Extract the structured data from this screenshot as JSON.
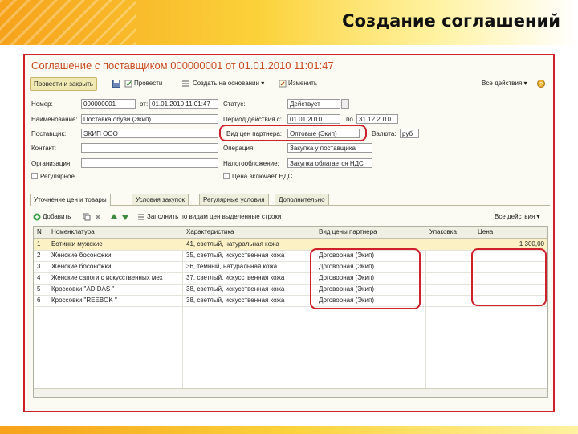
{
  "slide": {
    "title": "Создание соглашений"
  },
  "window": {
    "title": "Соглашение с поставщиком 000000001 от 01.01.2010 11:01:47"
  },
  "toolbar": {
    "post_close": "Провести и закрыть",
    "post": "Провести",
    "create_based": "Создать на основании",
    "edit": "Изменить",
    "all_actions": "Все действия"
  },
  "form": {
    "number_label": "Номер:",
    "number": "000000001",
    "from_label": "от:",
    "date": "01.01.2010 11:01:47",
    "status_label": "Статус:",
    "status": "Действует",
    "name_label": "Наименование:",
    "name": "Поставка обуви (Экип)",
    "period_label": "Период действия с:",
    "period_from": "01.01.2010",
    "to_label": "по",
    "period_to": "31.12.2010",
    "supplier_label": "Поставщик:",
    "supplier": "ЭКИП ООО",
    "price_type_label": "Вид цен партнера:",
    "price_type": "Оптовые (Экип)",
    "currency_label": "Валюта:",
    "currency": "руб",
    "contact_label": "Контакт:",
    "contact": "",
    "operation_label": "Операция:",
    "operation": "Закупка у поставщика",
    "org_label": "Организация:",
    "org": "",
    "tax_label": "Налогообложение:",
    "tax": "Закупка облагается НДС",
    "regular_label": "Регулярное",
    "vat_label": "Цена включает НДС"
  },
  "tabs": [
    "Уточнение цен и товары",
    "Условия закупок",
    "Регулярные условия",
    "Дополнительно"
  ],
  "subtoolbar": {
    "add": "Добавить",
    "fill": "Заполнить по видам цен выделенные строки",
    "all_actions": "Все действия"
  },
  "grid": {
    "headers": [
      "N",
      "Номенклатура",
      "Характеристика",
      "Вид цены партнера",
      "Упаковка",
      "Цена"
    ],
    "rows": [
      {
        "n": "1",
        "item": "Ботинки мужские",
        "char": "41, светлый, натуральная кожа",
        "price_type": "",
        "pack": "",
        "price": "1 300,00"
      },
      {
        "n": "2",
        "item": "Женские босоножки",
        "char": "35, светлый, искусственная кожа",
        "price_type": "Договорная (Экип)",
        "pack": "",
        "price": ""
      },
      {
        "n": "3",
        "item": "Женские босоножки",
        "char": "36, темный, натуральная кожа",
        "price_type": "Договорная (Экип)",
        "pack": "",
        "price": ""
      },
      {
        "n": "4",
        "item": "Женские сапоги с искусственных мех",
        "char": "37, светлый, искусственная кожа",
        "price_type": "Договорная (Экип)",
        "pack": "",
        "price": ""
      },
      {
        "n": "5",
        "item": "Кроссовки \"ADIDAS \"",
        "char": "38, светлый, искусственная кожа",
        "price_type": "Договорная (Экип)",
        "pack": "",
        "price": ""
      },
      {
        "n": "6",
        "item": "Кроссовки \"REEBOK \"",
        "char": "38, светлый, искусственная кожа",
        "price_type": "Договорная (Экип)",
        "pack": "",
        "price": ""
      }
    ]
  },
  "colors": {
    "highlight": "#d0202a",
    "title": "#c84a20",
    "header_orange": "#f6a21a"
  }
}
